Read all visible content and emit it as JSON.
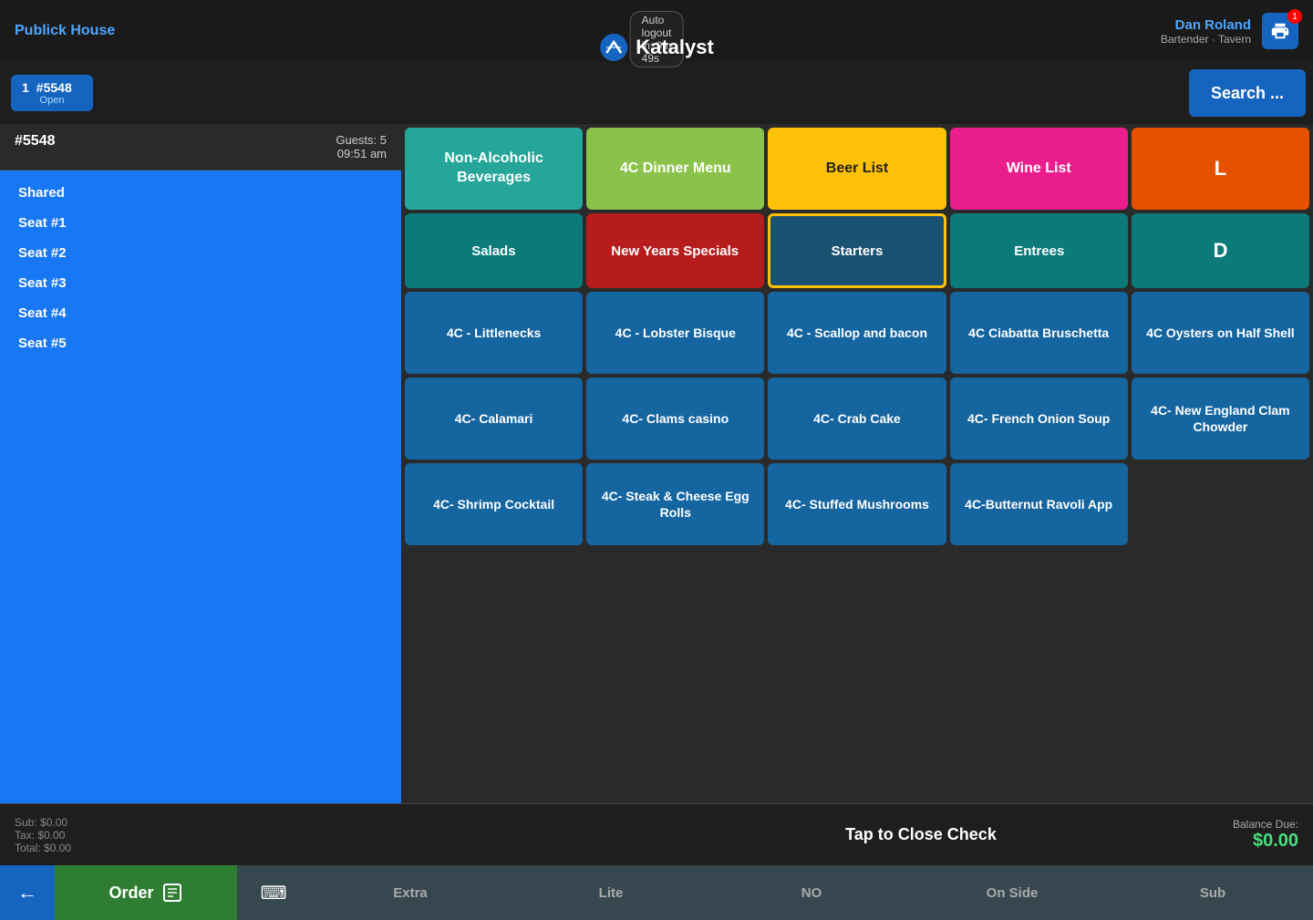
{
  "topBar": {
    "autoLogout": "Auto logout in: 9m 49s",
    "brandName": "Publick House",
    "appName": "Katalyst",
    "userName": "Dan Roland",
    "userRole": "Bartender · Tavern",
    "printBadge": "1",
    "searchLabel": "Search ..."
  },
  "orderTab": {
    "number": "1",
    "id": "#5548",
    "status": "Open"
  },
  "orderInfo": {
    "id": "#5548",
    "guests": "Guests: 5",
    "time": "09:51 am"
  },
  "seats": [
    {
      "label": "Shared"
    },
    {
      "label": "Seat #1"
    },
    {
      "label": "Seat #2"
    },
    {
      "label": "Seat #3"
    },
    {
      "label": "Seat #4"
    },
    {
      "label": "Seat #5"
    }
  ],
  "totals": {
    "sub": "Sub: $0.00",
    "tax": "Tax: $0.00",
    "total": "Total: $0.00",
    "tapClose": "Tap to Close Check",
    "balanceDueLabel": "Balance Due:",
    "balanceDue": "$0.00"
  },
  "menuCategories": [
    {
      "label": "Non-Alcoholic Beverages",
      "color": "cat-teal"
    },
    {
      "label": "4C  Dinner Menu",
      "color": "cat-yellow-green"
    },
    {
      "label": "Beer List",
      "color": "cat-yellow"
    },
    {
      "label": "Wine List",
      "color": "cat-pink"
    },
    {
      "label": "L",
      "color": "cat-orange"
    }
  ],
  "menuSubcats": [
    {
      "label": "Salads",
      "active": false,
      "color": "subcat-teal"
    },
    {
      "label": "New Years Specials",
      "active": false,
      "color": "subcat-crimson"
    },
    {
      "label": "Starters",
      "active": true,
      "color": "subcat-teal"
    },
    {
      "label": "Entrees",
      "active": false,
      "color": "subcat-teal"
    },
    {
      "label": "D",
      "active": false,
      "color": "subcat-teal"
    }
  ],
  "menuItems": [
    {
      "label": "4C - Littlenecks"
    },
    {
      "label": "4C - Lobster Bisque"
    },
    {
      "label": "4C - Scallop and bacon"
    },
    {
      "label": "4C Ciabatta Bruschetta"
    },
    {
      "label": "4C Oysters on Half Shell"
    },
    {
      "label": "4C-  Calamari"
    },
    {
      "label": "4C- Clams casino"
    },
    {
      "label": "4C- Crab Cake"
    },
    {
      "label": "4C- French Onion Soup"
    },
    {
      "label": "4C- New England Clam Chowder"
    },
    {
      "label": "4C- Shrimp Cocktail"
    },
    {
      "label": "4C- Steak & Cheese Egg Rolls"
    },
    {
      "label": "4C- Stuffed Mushrooms"
    },
    {
      "label": "4C-Butternut Ravoli App"
    }
  ],
  "footer": {
    "backLabel": "←",
    "orderLabel": "Order",
    "keyboardLabel": "⌨",
    "actions": [
      "Extra",
      "Lite",
      "NO",
      "On Side",
      "Sub"
    ]
  }
}
